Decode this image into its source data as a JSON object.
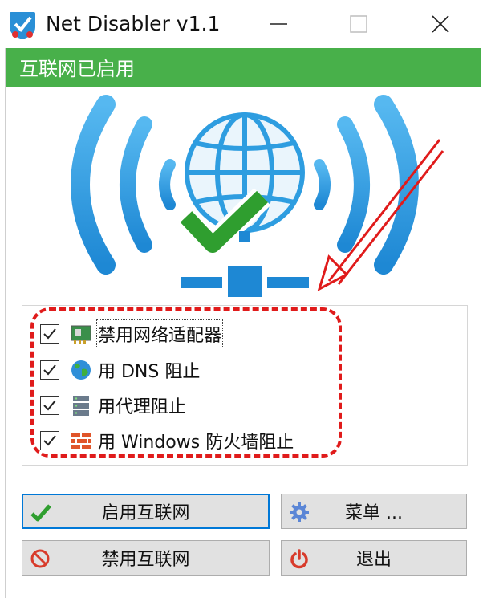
{
  "window": {
    "title": "Net Disabler v1.1",
    "controls": [
      "minimize",
      "maximize",
      "close"
    ]
  },
  "status": {
    "text": "互联网已启用",
    "color": "#48b04a"
  },
  "hero": {
    "icon": "globe-wifi-check-icon",
    "colors": {
      "arc": "#2e9de0",
      "check": "#2f9e2f"
    }
  },
  "options": [
    {
      "label": "禁用网络适配器",
      "checked": true,
      "icon": "network-adapter-icon"
    },
    {
      "label": "用 DNS 阻止",
      "checked": true,
      "icon": "earth-icon"
    },
    {
      "label": "用代理阻止",
      "checked": true,
      "icon": "server-icon"
    },
    {
      "label": "用 Windows 防火墙阻止",
      "checked": true,
      "icon": "firewall-icon"
    }
  ],
  "buttons": {
    "enable": {
      "label": "启用互联网",
      "icon": "checkmark-icon"
    },
    "menu": {
      "label": "菜单 ...",
      "icon": "gear-icon"
    },
    "disable": {
      "label": "禁用互联网",
      "icon": "prohibited-icon"
    },
    "exit": {
      "label": "退出",
      "icon": "power-icon"
    }
  },
  "annotation": {
    "color": "#e01b1b"
  }
}
